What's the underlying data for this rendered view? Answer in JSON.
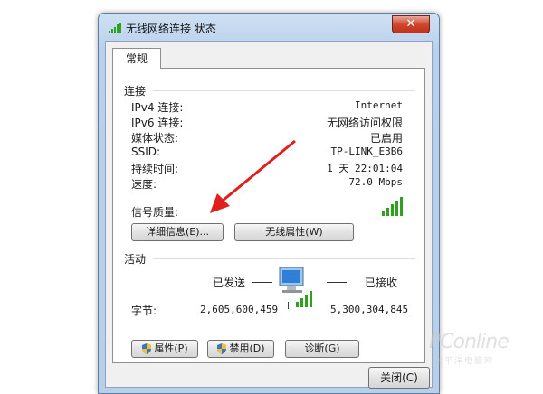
{
  "window": {
    "title": "无线网络连接 状态",
    "close_symbol": "✕"
  },
  "tabs": {
    "general": "常规"
  },
  "connection": {
    "heading": "连接",
    "rows": [
      {
        "label": "IPv4 连接:",
        "value": "Internet"
      },
      {
        "label": "IPv6 连接:",
        "value": "无网络访问权限"
      },
      {
        "label": "媒体状态:",
        "value": "已启用"
      },
      {
        "label": "SSID:",
        "value": "TP-LINK_E3B6"
      },
      {
        "label": "持续时间:",
        "value": "1 天 22:01:04"
      },
      {
        "label": "速度:",
        "value": "72.0 Mbps"
      }
    ],
    "signal_label": "信号质量:",
    "signal_bars": 5,
    "details_button": "详细信息(E)...",
    "wireless_props_button": "无线属性(W)"
  },
  "activity": {
    "heading": "活动",
    "sent_label": "已发送",
    "received_label": "已接收",
    "bytes_label": "字节:",
    "bytes_sent": "2,605,600,459",
    "bytes_received": "5,300,304,845"
  },
  "actions": {
    "properties_button": "属性(P)",
    "disable_button": "禁用(D)",
    "diagnose_button": "诊断(G)"
  },
  "footer": {
    "close_button": "关闭(C)"
  },
  "watermark": {
    "brand": "PConline",
    "sub": "太平洋电脑网"
  },
  "colors": {
    "signal_green": "#2fa11f",
    "arrow_red": "#e0201c",
    "title_gradient": "#b9d1ec"
  }
}
